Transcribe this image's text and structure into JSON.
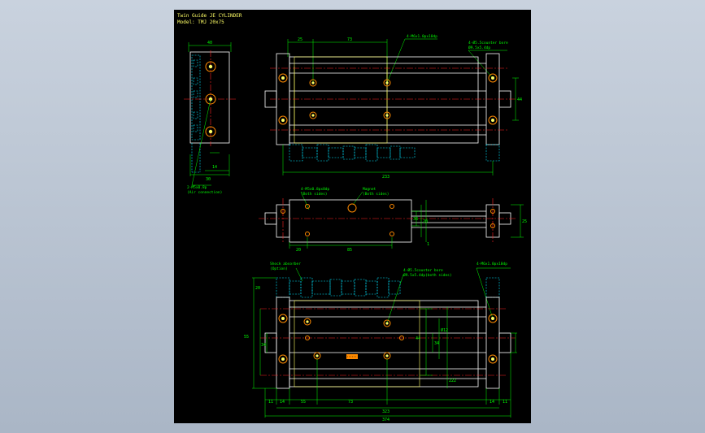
{
  "title": {
    "line1": "Twin Guide JE CYLINDER",
    "line2": "Model: TMJ 20x75"
  },
  "colors": {
    "background": "#000000",
    "outline": "#ffffff",
    "dimension": "#00ff00",
    "centerline": "#ff2020",
    "hidden": "#00e5ff",
    "body_edge": "#ffff66",
    "port": "#ff8a00"
  },
  "side_view": {
    "width": "40",
    "bottom": "14",
    "base": "30",
    "note_line1": "2-M5x0.8p",
    "note_line2": "(Air connection)"
  },
  "top_view": {
    "dims": [
      "25",
      "73"
    ],
    "note_mount": "4-M6x1.0px10dp",
    "note_right_line1": "4-Ø5.5counter bore",
    "note_right_line2": "Ø9.5x5.4dp",
    "right_height": "44",
    "total_length": "233"
  },
  "middle_view": {
    "note_mount_line1": "4-M5x0.8px8dp",
    "note_mount_line2": "(Both sides)",
    "note_magnet_line1": "Magnet",
    "note_magnet_line2": "(Both sides)",
    "dims_bottom": [
      "20",
      "85"
    ],
    "right_dims": [
      "38",
      "20",
      "25"
    ],
    "right_small": "1"
  },
  "bottom_view": {
    "note_shock_line1": "Shock absorber",
    "note_shock_line2": "(Option)",
    "note_cb_line1": "4-Ø5.5counter bore",
    "note_cb_line2": "Ø9.5x5.4dp(both sides)",
    "note_right": "4-M6x1.0px10dp",
    "left_dims": [
      "20",
      "55",
      "34"
    ],
    "inner_dims": [
      "44",
      "34"
    ],
    "center_dim": "Ø12",
    "right_dim": "222",
    "bottom_dims": [
      "11",
      "14",
      "55",
      "73",
      "14",
      "11"
    ],
    "dim_323": "323",
    "dim_374": "374"
  }
}
